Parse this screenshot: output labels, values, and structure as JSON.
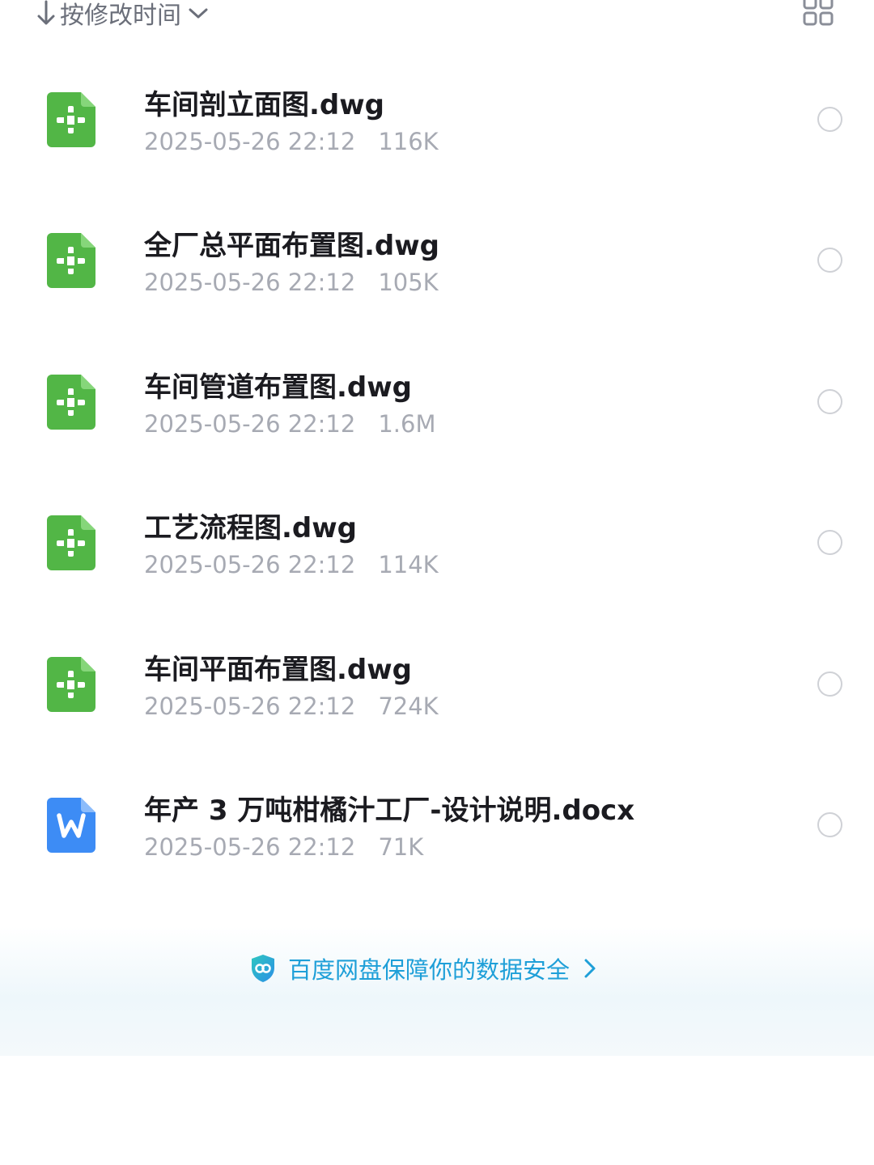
{
  "sort": {
    "label": "按修改时间"
  },
  "files": [
    {
      "name": "车间剖立面图.dwg",
      "date": "2025-05-26 22:12",
      "size": "116K",
      "type": "dwg"
    },
    {
      "name": "全厂总平面布置图.dwg",
      "date": "2025-05-26 22:12",
      "size": "105K",
      "type": "dwg"
    },
    {
      "name": "车间管道布置图.dwg",
      "date": "2025-05-26 22:12",
      "size": "1.6M",
      "type": "dwg"
    },
    {
      "name": "工艺流程图.dwg",
      "date": "2025-05-26 22:12",
      "size": "114K",
      "type": "dwg"
    },
    {
      "name": "车间平面布置图.dwg",
      "date": "2025-05-26 22:12",
      "size": "724K",
      "type": "dwg"
    },
    {
      "name": "年产 3 万吨柑橘汁工厂-设计说明.docx",
      "date": "2025-05-26 22:12",
      "size": "71K",
      "type": "docx"
    }
  ],
  "security": {
    "text": "百度网盘保障你的数据安全"
  },
  "icons": {
    "dwg": "cad-file-icon",
    "docx": "word-file-icon",
    "sort": "arrow-down-icon",
    "view": "grid-view-icon",
    "shield": "shield-icon"
  },
  "colors": {
    "dwg_icon": "#52b646",
    "docx_icon": "#3d8cf5",
    "link": "#1e9fd8",
    "meta_text": "#a7aab3"
  }
}
